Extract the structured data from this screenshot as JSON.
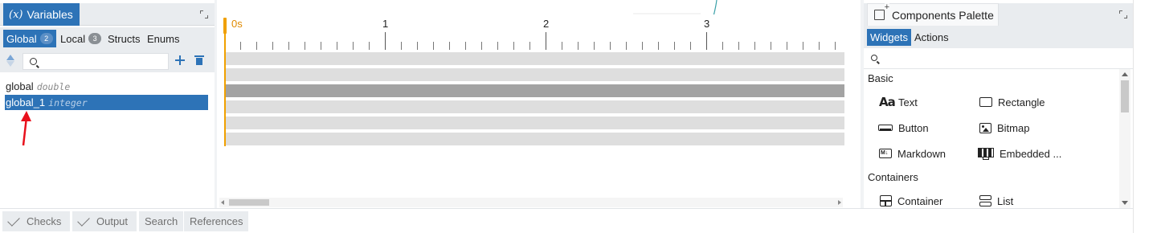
{
  "variables_panel": {
    "title": "Variables",
    "title_icon": "(x)",
    "tabs": [
      {
        "label": "Global",
        "badge": "2",
        "active": true
      },
      {
        "label": "Local",
        "badge": "3",
        "active": false
      },
      {
        "label": "Structs",
        "badge": "",
        "active": false
      },
      {
        "label": "Enums",
        "badge": "",
        "active": false
      }
    ],
    "search": {
      "value": "",
      "placeholder": ""
    },
    "items": [
      {
        "name": "global",
        "type": "double",
        "selected": false
      },
      {
        "name": "global_1",
        "type": "integer",
        "selected": true
      }
    ]
  },
  "timeline": {
    "ruler_labels": [
      "0s",
      "1",
      "2",
      "3"
    ],
    "track_count": 6,
    "highlighted_track": 3
  },
  "components_palette": {
    "title": "Components Palette",
    "tabs": [
      {
        "label": "Widgets",
        "active": true
      },
      {
        "label": "Actions",
        "active": false
      }
    ],
    "search": {
      "value": "",
      "placeholder": ""
    },
    "sections": [
      {
        "label": "Basic",
        "items": [
          {
            "label": "Text",
            "icon": "text-icon"
          },
          {
            "label": "Rectangle",
            "icon": "rectangle-icon"
          },
          {
            "label": "Button",
            "icon": "button-icon"
          },
          {
            "label": "Bitmap",
            "icon": "bitmap-icon"
          },
          {
            "label": "Markdown",
            "icon": "markdown-icon"
          },
          {
            "label": "Embedded ...",
            "icon": "embedded-icon"
          }
        ]
      },
      {
        "label": "Containers",
        "items": [
          {
            "label": "Container",
            "icon": "container-icon"
          },
          {
            "label": "List",
            "icon": "list-icon"
          }
        ]
      }
    ]
  },
  "bottom_tabs": [
    {
      "label": "Checks",
      "icon": "check-icon"
    },
    {
      "label": "Output",
      "icon": "check-icon"
    },
    {
      "label": "Search",
      "icon": ""
    },
    {
      "label": "References",
      "icon": ""
    }
  ],
  "colors": {
    "accent": "#2d73b7",
    "playhead": "#f0a000",
    "annotation_arrow": "#e8101c"
  }
}
